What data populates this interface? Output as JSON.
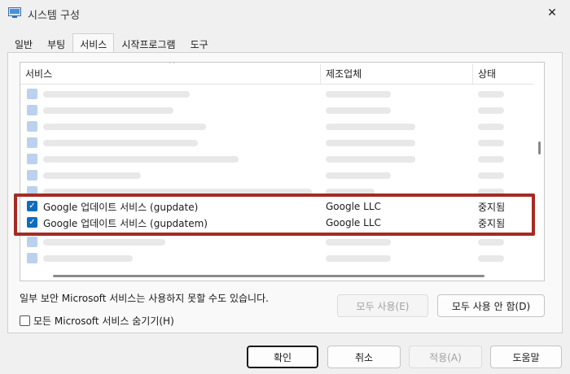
{
  "window": {
    "title": "시스템 구성",
    "close_glyph": "✕"
  },
  "tabs": [
    {
      "label": "일반",
      "active": false
    },
    {
      "label": "부팅",
      "active": false
    },
    {
      "label": "서비스",
      "active": true
    },
    {
      "label": "시작프로그램",
      "active": false
    },
    {
      "label": "도구",
      "active": false
    }
  ],
  "list": {
    "sort_glyph": "^",
    "columns": {
      "service": "서비스",
      "manufacturer": "제조업체",
      "status": "상태"
    },
    "rows": [
      {
        "checked": true,
        "service": "Google 업데이트 서비스 (gupdate)",
        "manufacturer": "Google LLC",
        "status": "중지됨"
      },
      {
        "checked": true,
        "service": "Google 업데이트 서비스 (gupdatem)",
        "manufacturer": "Google LLC",
        "status": "중지됨"
      }
    ]
  },
  "note": "일부 보안 Microsoft 서비스는 사용하지 못할 수도 있습니다.",
  "buttons": {
    "enable_all": "모두 사용(E)",
    "disable_all": "모두 사용 안 함(D)",
    "ok": "확인",
    "cancel": "취소",
    "apply": "적용(A)",
    "help": "도움말"
  },
  "hide_ms": {
    "label": "모든 Microsoft 서비스 숨기기(H)",
    "checked": false
  },
  "colors": {
    "highlight": "#a42b24",
    "checkbox": "#0f6cbd"
  },
  "icons": {
    "app": "msconfig-icon",
    "check": "checkmark-icon"
  }
}
